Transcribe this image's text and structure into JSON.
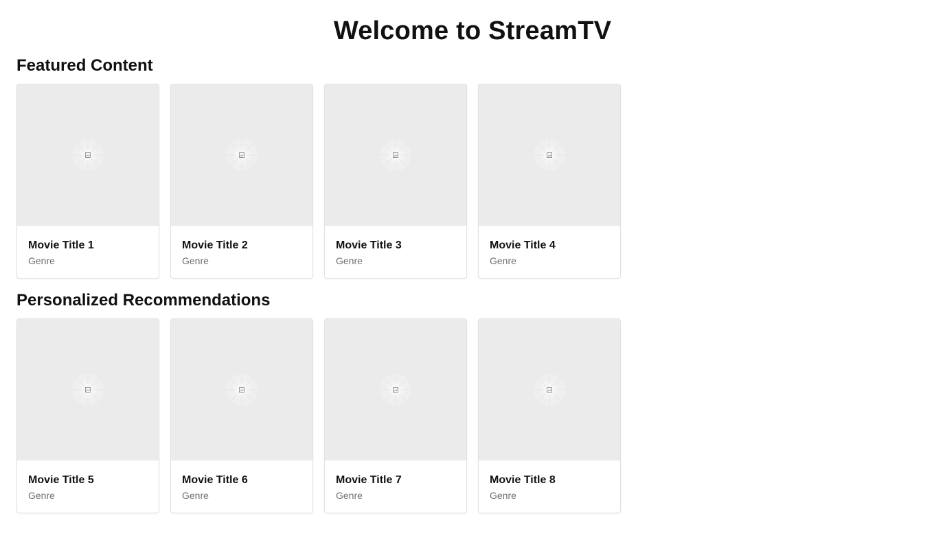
{
  "header": {
    "title": "Welcome to StreamTV"
  },
  "sections": [
    {
      "title": "Featured Content",
      "items": [
        {
          "title": "Movie Title 1",
          "genre": "Genre"
        },
        {
          "title": "Movie Title 2",
          "genre": "Genre"
        },
        {
          "title": "Movie Title 3",
          "genre": "Genre"
        },
        {
          "title": "Movie Title 4",
          "genre": "Genre"
        }
      ]
    },
    {
      "title": "Personalized Recommendations",
      "items": [
        {
          "title": "Movie Title 5",
          "genre": "Genre"
        },
        {
          "title": "Movie Title 6",
          "genre": "Genre"
        },
        {
          "title": "Movie Title 7",
          "genre": "Genre"
        },
        {
          "title": "Movie Title 8",
          "genre": "Genre"
        }
      ]
    }
  ],
  "icons": {
    "thumbnail": "image-placeholder-icon"
  },
  "colors": {
    "thumbnail_bg": "#ebebeb",
    "genre_text": "#6e6e6e",
    "heading_text": "#111111"
  }
}
